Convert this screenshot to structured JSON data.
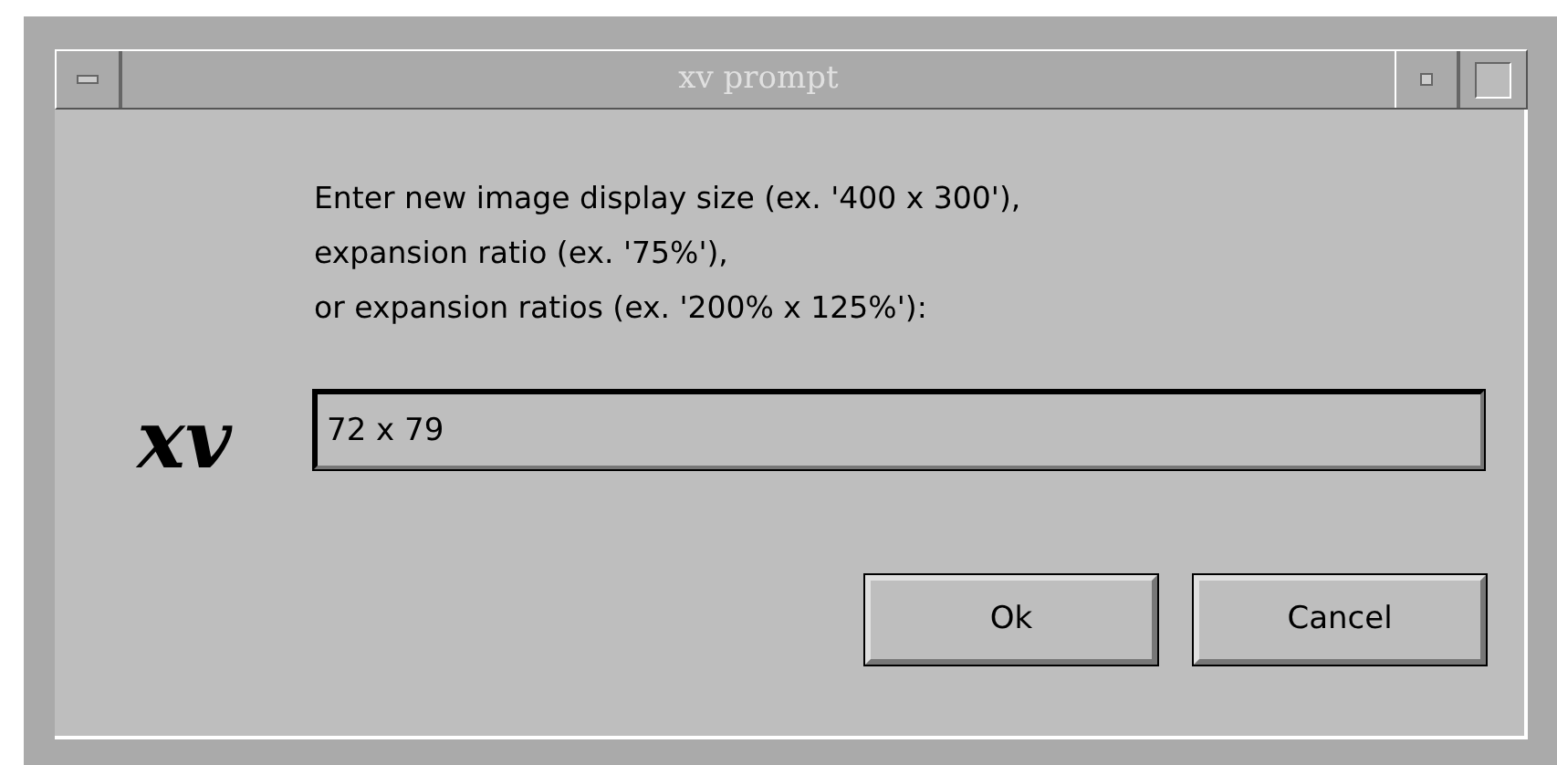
{
  "window": {
    "title": "xv prompt"
  },
  "logo": {
    "text": "xv"
  },
  "prompt_lines": [
    "Enter new image display size (ex. '400 x 300'),",
    "expansion ratio (ex. '75%'),",
    "or expansion ratios (ex. '200% x 125%'):"
  ],
  "input": {
    "value": "72 x 79"
  },
  "buttons": [
    "Ok",
    "Cancel"
  ]
}
